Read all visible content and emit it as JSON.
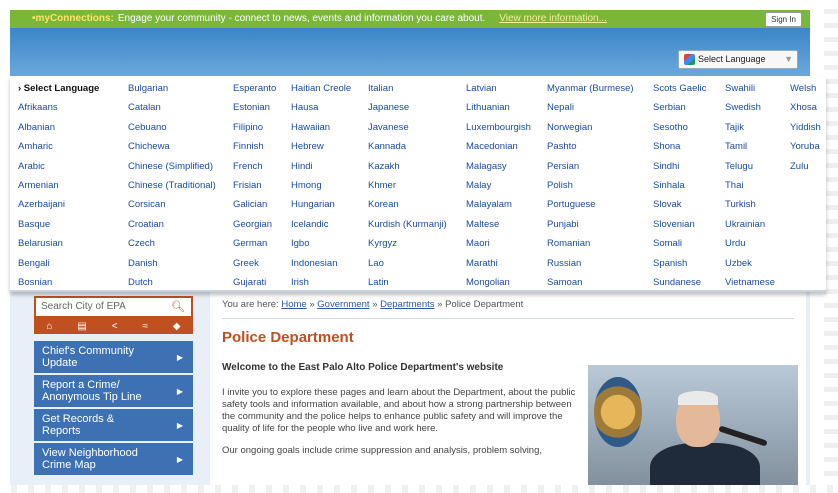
{
  "topbar": {
    "brand": "•myConnections:",
    "message": "Engage your community - connect to news, events and information you care about.",
    "more_link": "View more information...",
    "sign_in": "Sign In"
  },
  "language_button": {
    "label": "Select Language",
    "arrow": "▼"
  },
  "language_menu": {
    "header": "› Select Language",
    "columns": [
      [
        "Afrikaans",
        "Albanian",
        "Amharic",
        "Arabic",
        "Armenian",
        "Azerbaijani",
        "Basque",
        "Belarusian",
        "Bengali",
        "Bosnian"
      ],
      [
        "Bulgarian",
        "Catalan",
        "Cebuano",
        "Chichewa",
        "Chinese (Simplified)",
        "Chinese (Traditional)",
        "Corsican",
        "Croatian",
        "Czech",
        "Danish",
        "Dutch"
      ],
      [
        "Esperanto",
        "Estonian",
        "Filipino",
        "Finnish",
        "French",
        "Frisian",
        "Galician",
        "Georgian",
        "German",
        "Greek",
        "Gujarati"
      ],
      [
        "Haitian Creole",
        "Hausa",
        "Hawaiian",
        "Hebrew",
        "Hindi",
        "Hmong",
        "Hungarian",
        "Icelandic",
        "Igbo",
        "Indonesian",
        "Irish"
      ],
      [
        "Italian",
        "Japanese",
        "Javanese",
        "Kannada",
        "Kazakh",
        "Khmer",
        "Korean",
        "Kurdish (Kurmanji)",
        "Kyrgyz",
        "Lao",
        "Latin"
      ],
      [
        "Latvian",
        "Lithuanian",
        "Luxembourgish",
        "Macedonian",
        "Malagasy",
        "Malay",
        "Malayalam",
        "Maltese",
        "Maori",
        "Marathi",
        "Mongolian"
      ],
      [
        "Myanmar (Burmese)",
        "Nepali",
        "Norwegian",
        "Pashto",
        "Persian",
        "Polish",
        "Portuguese",
        "Punjabi",
        "Romanian",
        "Russian",
        "Samoan"
      ],
      [
        "Scots Gaelic",
        "Serbian",
        "Sesotho",
        "Shona",
        "Sindhi",
        "Sinhala",
        "Slovak",
        "Slovenian",
        "Somali",
        "Spanish",
        "Sundanese"
      ],
      [
        "Swahili",
        "Swedish",
        "Tajik",
        "Tamil",
        "Telugu",
        "Thai",
        "Turkish",
        "Ukrainian",
        "Urdu",
        "Uzbek",
        "Vietnamese"
      ],
      [
        "Welsh",
        "Xhosa",
        "Yiddish",
        "Yoruba",
        "Zulu"
      ]
    ]
  },
  "search": {
    "placeholder": "Search City of EPA"
  },
  "nav": [
    {
      "line1": "Chief's Community",
      "line2": "Update"
    },
    {
      "line1": "Report a Crime/",
      "line2": "Anonymous Tip Line"
    },
    {
      "line1": "Get Records &",
      "line2": "Reports"
    },
    {
      "line1": "View Neighborhood",
      "line2": "Crime Map"
    }
  ],
  "breadcrumb": {
    "prefix": "You are here:",
    "home": "Home",
    "government": "Government",
    "departments": "Departments",
    "current": "Police Department",
    "sep": "»"
  },
  "page": {
    "title": "Police Department",
    "welcome": "Welcome to the East Palo Alto Police Department's website",
    "paragraph": "I invite you to explore these pages and learn about the Department, about the public safety tools and information available, and about how a strong partnership between the community and the police helps to enhance public safety and will improve the quality of life for the people who live and work here.",
    "paragraph2": "Our ongoing goals include crime suppression and analysis, problem solving,"
  },
  "colors": {
    "accent": "#c0501f",
    "nav": "#3e70b4",
    "topbar": "#7ab63a",
    "link": "#1a4a9e"
  }
}
